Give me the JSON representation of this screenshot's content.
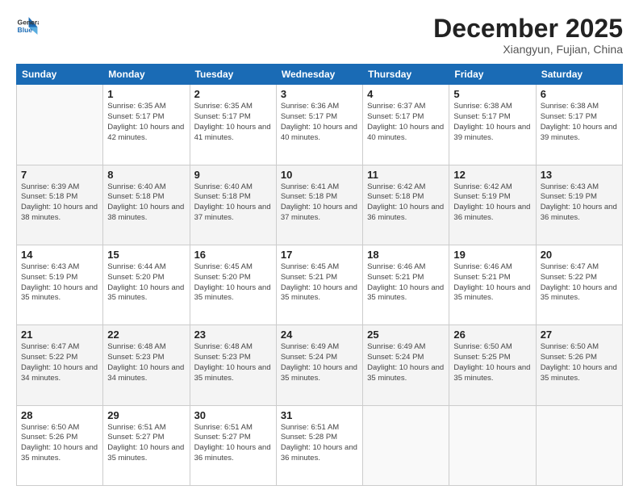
{
  "logo": {
    "line1": "General",
    "line2": "Blue"
  },
  "header": {
    "month": "December 2025",
    "location": "Xiangyun, Fujian, China"
  },
  "weekdays": [
    "Sunday",
    "Monday",
    "Tuesday",
    "Wednesday",
    "Thursday",
    "Friday",
    "Saturday"
  ],
  "weeks": [
    [
      {
        "day": "",
        "info": ""
      },
      {
        "day": "1",
        "info": "Sunrise: 6:35 AM\nSunset: 5:17 PM\nDaylight: 10 hours\nand 42 minutes."
      },
      {
        "day": "2",
        "info": "Sunrise: 6:35 AM\nSunset: 5:17 PM\nDaylight: 10 hours\nand 41 minutes."
      },
      {
        "day": "3",
        "info": "Sunrise: 6:36 AM\nSunset: 5:17 PM\nDaylight: 10 hours\nand 40 minutes."
      },
      {
        "day": "4",
        "info": "Sunrise: 6:37 AM\nSunset: 5:17 PM\nDaylight: 10 hours\nand 40 minutes."
      },
      {
        "day": "5",
        "info": "Sunrise: 6:38 AM\nSunset: 5:17 PM\nDaylight: 10 hours\nand 39 minutes."
      },
      {
        "day": "6",
        "info": "Sunrise: 6:38 AM\nSunset: 5:17 PM\nDaylight: 10 hours\nand 39 minutes."
      }
    ],
    [
      {
        "day": "7",
        "info": "Sunrise: 6:39 AM\nSunset: 5:18 PM\nDaylight: 10 hours\nand 38 minutes."
      },
      {
        "day": "8",
        "info": "Sunrise: 6:40 AM\nSunset: 5:18 PM\nDaylight: 10 hours\nand 38 minutes."
      },
      {
        "day": "9",
        "info": "Sunrise: 6:40 AM\nSunset: 5:18 PM\nDaylight: 10 hours\nand 37 minutes."
      },
      {
        "day": "10",
        "info": "Sunrise: 6:41 AM\nSunset: 5:18 PM\nDaylight: 10 hours\nand 37 minutes."
      },
      {
        "day": "11",
        "info": "Sunrise: 6:42 AM\nSunset: 5:18 PM\nDaylight: 10 hours\nand 36 minutes."
      },
      {
        "day": "12",
        "info": "Sunrise: 6:42 AM\nSunset: 5:19 PM\nDaylight: 10 hours\nand 36 minutes."
      },
      {
        "day": "13",
        "info": "Sunrise: 6:43 AM\nSunset: 5:19 PM\nDaylight: 10 hours\nand 36 minutes."
      }
    ],
    [
      {
        "day": "14",
        "info": "Sunrise: 6:43 AM\nSunset: 5:19 PM\nDaylight: 10 hours\nand 35 minutes."
      },
      {
        "day": "15",
        "info": "Sunrise: 6:44 AM\nSunset: 5:20 PM\nDaylight: 10 hours\nand 35 minutes."
      },
      {
        "day": "16",
        "info": "Sunrise: 6:45 AM\nSunset: 5:20 PM\nDaylight: 10 hours\nand 35 minutes."
      },
      {
        "day": "17",
        "info": "Sunrise: 6:45 AM\nSunset: 5:21 PM\nDaylight: 10 hours\nand 35 minutes."
      },
      {
        "day": "18",
        "info": "Sunrise: 6:46 AM\nSunset: 5:21 PM\nDaylight: 10 hours\nand 35 minutes."
      },
      {
        "day": "19",
        "info": "Sunrise: 6:46 AM\nSunset: 5:21 PM\nDaylight: 10 hours\nand 35 minutes."
      },
      {
        "day": "20",
        "info": "Sunrise: 6:47 AM\nSunset: 5:22 PM\nDaylight: 10 hours\nand 35 minutes."
      }
    ],
    [
      {
        "day": "21",
        "info": "Sunrise: 6:47 AM\nSunset: 5:22 PM\nDaylight: 10 hours\nand 34 minutes."
      },
      {
        "day": "22",
        "info": "Sunrise: 6:48 AM\nSunset: 5:23 PM\nDaylight: 10 hours\nand 34 minutes."
      },
      {
        "day": "23",
        "info": "Sunrise: 6:48 AM\nSunset: 5:23 PM\nDaylight: 10 hours\nand 35 minutes."
      },
      {
        "day": "24",
        "info": "Sunrise: 6:49 AM\nSunset: 5:24 PM\nDaylight: 10 hours\nand 35 minutes."
      },
      {
        "day": "25",
        "info": "Sunrise: 6:49 AM\nSunset: 5:24 PM\nDaylight: 10 hours\nand 35 minutes."
      },
      {
        "day": "26",
        "info": "Sunrise: 6:50 AM\nSunset: 5:25 PM\nDaylight: 10 hours\nand 35 minutes."
      },
      {
        "day": "27",
        "info": "Sunrise: 6:50 AM\nSunset: 5:26 PM\nDaylight: 10 hours\nand 35 minutes."
      }
    ],
    [
      {
        "day": "28",
        "info": "Sunrise: 6:50 AM\nSunset: 5:26 PM\nDaylight: 10 hours\nand 35 minutes."
      },
      {
        "day": "29",
        "info": "Sunrise: 6:51 AM\nSunset: 5:27 PM\nDaylight: 10 hours\nand 35 minutes."
      },
      {
        "day": "30",
        "info": "Sunrise: 6:51 AM\nSunset: 5:27 PM\nDaylight: 10 hours\nand 36 minutes."
      },
      {
        "day": "31",
        "info": "Sunrise: 6:51 AM\nSunset: 5:28 PM\nDaylight: 10 hours\nand 36 minutes."
      },
      {
        "day": "",
        "info": ""
      },
      {
        "day": "",
        "info": ""
      },
      {
        "day": "",
        "info": ""
      }
    ]
  ]
}
